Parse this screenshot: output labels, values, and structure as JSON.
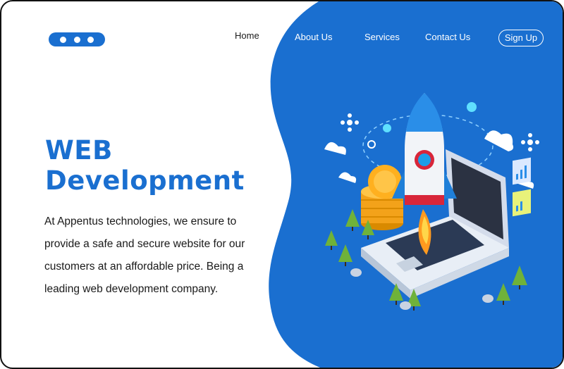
{
  "nav": {
    "logo_icon": "menu-dots-icon",
    "items": [
      {
        "label": "Home"
      },
      {
        "label": "About Us"
      },
      {
        "label": "Services"
      },
      {
        "label": "Contact Us"
      }
    ],
    "signup_label": "Sign Up"
  },
  "hero": {
    "title_line1": "WEB",
    "title_line2": "Development",
    "description": "At Appentus technologies, we ensure to provide a safe and secure website for our customers at an affordable price. Being a leading web development company."
  },
  "colors": {
    "brand_blue": "#1a6fd0",
    "background": "#ffffff",
    "text": "#1a1a1a"
  }
}
